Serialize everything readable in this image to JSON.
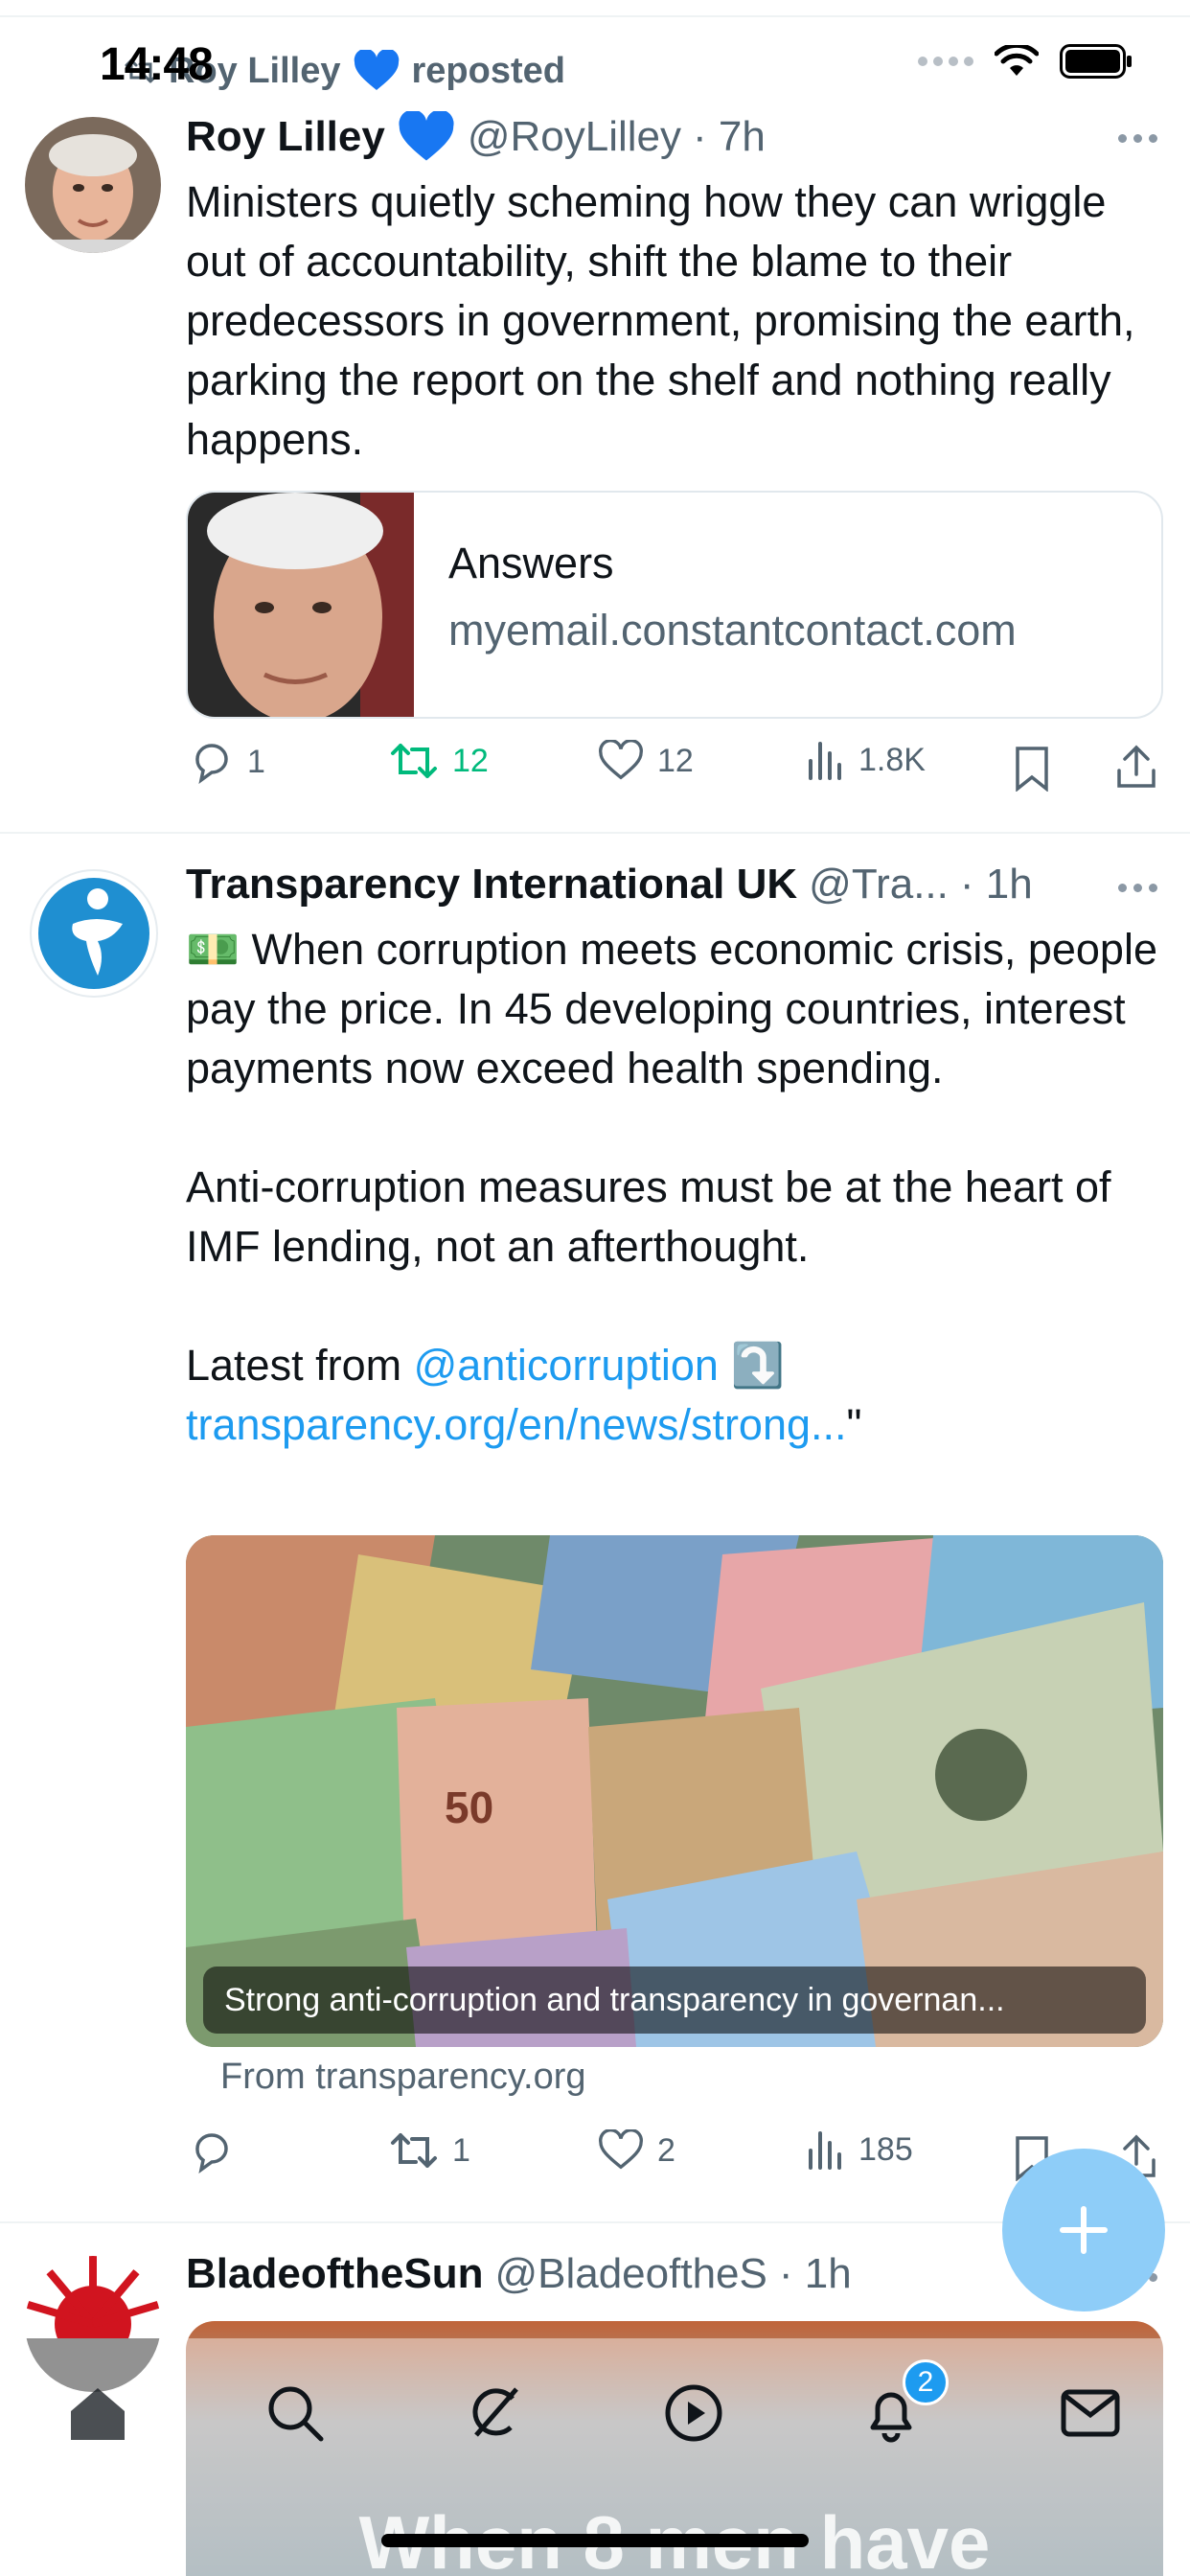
{
  "status_bar": {
    "time": "14:48"
  },
  "repost": {
    "text": "Roy Lilley",
    "suffix": "reposted"
  },
  "tweet1": {
    "name": "Roy Lilley",
    "handle": "@RoyLilley",
    "time": "· 7h",
    "text": "Ministers quietly scheming how they can wriggle out of accountability, shift the blame to their predecessors in government, promising the earth, parking the report on the shelf and nothing really happens.",
    "card": {
      "title": "Answers",
      "domain": "myemail.constantcontact.com"
    },
    "stats": {
      "replies": "1",
      "reposts": "12",
      "likes": "12",
      "views": "1.8K"
    }
  },
  "tweet2": {
    "name": "Transparency International UK",
    "handle": "@Tra...",
    "time": "· 1h",
    "emoji": "💵",
    "line1": "When corruption meets economic crisis, people pay the price. In 45 developing countries, interest payments now exceed health spending.",
    "line2": "Anti-corruption measures must be at the heart of IMF lending, not an afterthought.",
    "line3_prefix": "Latest from",
    "mention": "@anticorruption",
    "arrow": "⤵️",
    "url": "transparency.org/en/news/strong...",
    "url_suffix": "\"",
    "media_caption": "Strong anti-corruption and transparency in governan...",
    "from": "From transparency.org",
    "stats": {
      "replies": "",
      "reposts": "1",
      "likes": "2",
      "views": "185"
    }
  },
  "tweet3": {
    "name": "BladeoftheSun",
    "handle": "@BladeoftheS",
    "time": "· 1h",
    "media_text": "When 8 men have"
  },
  "tabbar": {
    "notifications_badge": "2"
  },
  "colors": {
    "accent": "#1d9bf0",
    "repost_green": "#00ba7c",
    "muted": "#536471",
    "fab": "#8ecdf8"
  }
}
